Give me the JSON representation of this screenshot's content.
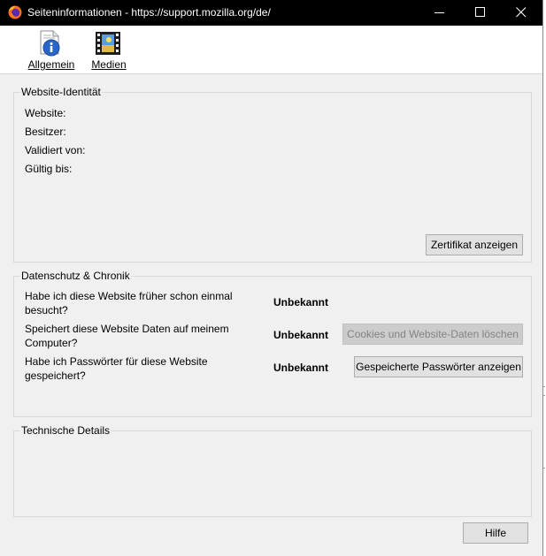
{
  "window": {
    "title": "Seiteninformationen - https://support.mozilla.org/de/"
  },
  "toolbar": {
    "items": [
      {
        "label": "Allgemein",
        "icon": "info-icon"
      },
      {
        "label": "Medien",
        "icon": "media-icon"
      }
    ]
  },
  "identity": {
    "title": "Website-Identität",
    "website_label": "Website:",
    "owner_label": "Besitzer:",
    "verified_label": "Validiert von:",
    "valid_until_label": "Gültig bis:",
    "cert_button": "Zertifikat anzeigen"
  },
  "privacy": {
    "title": "Datenschutz & Chronik",
    "rows": [
      {
        "question": "Habe ich diese Website früher schon einmal besucht?",
        "value": "Unbekannt"
      },
      {
        "question": "Speichert diese Website Daten auf meinem Computer?",
        "value": "Unbekannt",
        "button": "Cookies und Website-Daten löschen"
      },
      {
        "question": "Habe ich Passwörter für diese Website gespeichert?",
        "value": "Unbekannt",
        "button": "Gespeicherte Passwörter anzeigen"
      }
    ]
  },
  "technical": {
    "title": "Technische Details"
  },
  "footer": {
    "help_button": "Hilfe"
  },
  "colors": {
    "titlebar": "#000000",
    "dialog_bg": "#f0f0f0",
    "button_bg": "#e1e1e1",
    "disabled_button_bg": "#cccccc"
  }
}
